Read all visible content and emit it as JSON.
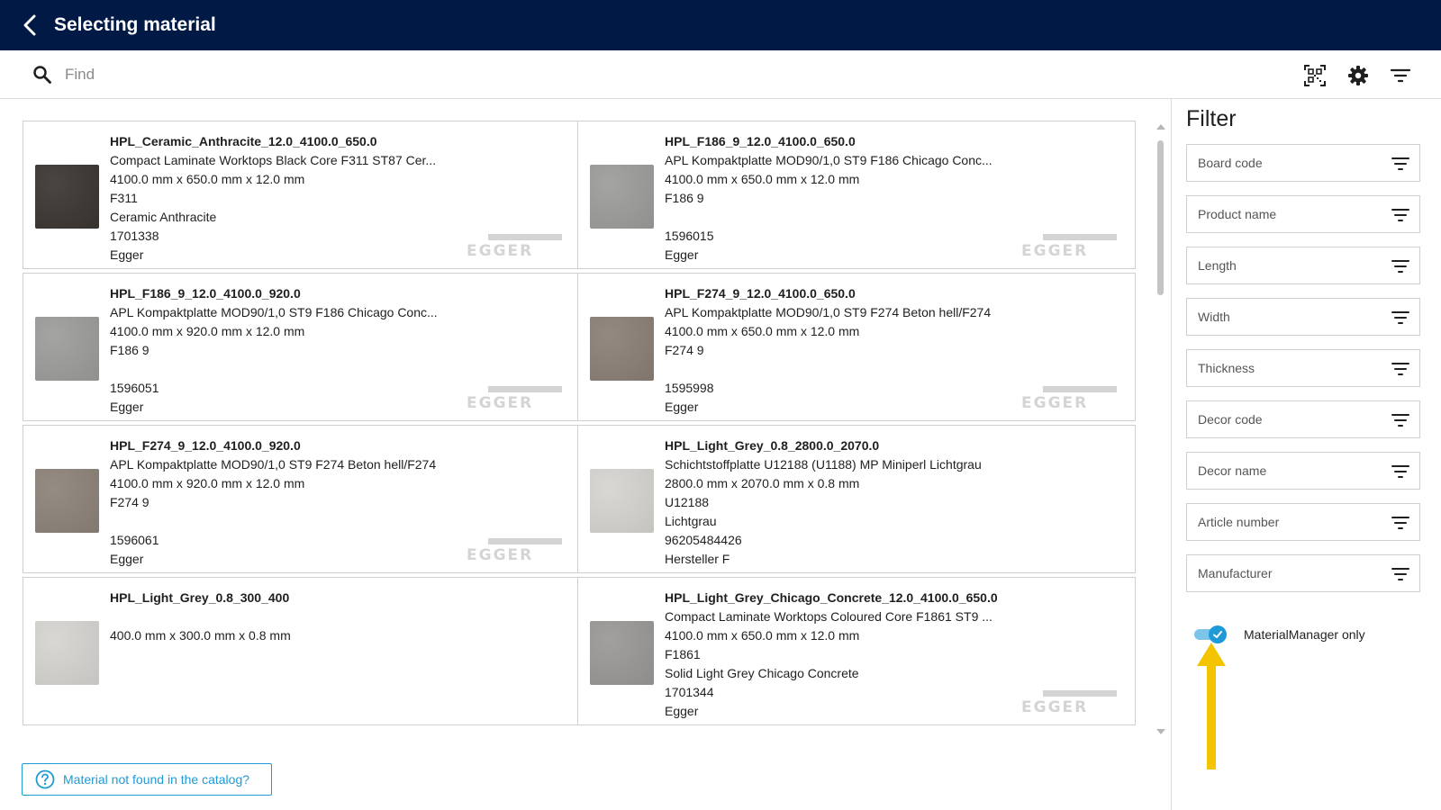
{
  "header": {
    "title": "Selecting material"
  },
  "search": {
    "placeholder": "Find"
  },
  "materials": [
    {
      "name": "HPL_Ceramic_Anthracite_12.0_4100.0_650.0",
      "desc": "Compact Laminate Worktops Black Core F311 ST87 Cer...",
      "dims": "4100.0 mm x 650.0 mm x 12.0 mm",
      "decor_code": "F311",
      "decor_name": "Ceramic Anthracite",
      "article": "1701338",
      "manufacturer": "Egger",
      "swatch": "#3a3530",
      "logo": "EGGER"
    },
    {
      "name": "HPL_F186_9_12.0_4100.0_650.0",
      "desc": "APL Kompaktplatte MOD90/1,0 ST9 F186 Chicago Conc...",
      "dims": "4100.0 mm x 650.0 mm x 12.0 mm",
      "decor_code": "F186 9",
      "decor_name": "",
      "article": "1596015",
      "manufacturer": "Egger",
      "swatch": "#9c9c9a",
      "logo": "EGGER"
    },
    {
      "name": "HPL_F186_9_12.0_4100.0_920.0",
      "desc": "APL Kompaktplatte MOD90/1,0 ST9 F186 Chicago Conc...",
      "dims": "4100.0 mm x 920.0 mm x 12.0 mm",
      "decor_code": "F186 9",
      "decor_name": "",
      "article": "1596051",
      "manufacturer": "Egger",
      "swatch": "#9c9c9a",
      "logo": "EGGER"
    },
    {
      "name": "HPL_F274_9_12.0_4100.0_650.0",
      "desc": "APL Kompaktplatte MOD90/1,0 ST9 F274 Beton hell/F274",
      "dims": "4100.0 mm x 650.0 mm x 12.0 mm",
      "decor_code": "F274 9",
      "decor_name": "",
      "article": "1595998",
      "manufacturer": "Egger",
      "swatch": "#8a7f75",
      "logo": "EGGER"
    },
    {
      "name": "HPL_F274_9_12.0_4100.0_920.0",
      "desc": "APL Kompaktplatte MOD90/1,0 ST9 F274 Beton hell/F274",
      "dims": "4100.0 mm x 920.0 mm x 12.0 mm",
      "decor_code": "F274 9",
      "decor_name": "",
      "article": "1596061",
      "manufacturer": "Egger",
      "swatch": "#8c8278",
      "logo": "EGGER"
    },
    {
      "name": "HPL_Light_Grey_0.8_2800.0_2070.0",
      "desc": "Schichtstoffplatte U12188 (U1188) MP Miniperl Lichtgrau",
      "dims": "2800.0 mm x 2070.0 mm x 0.8 mm",
      "decor_code": "U12188",
      "decor_name": "Lichtgrau",
      "article": "96205484426",
      "manufacturer": "Hersteller F",
      "swatch": "#d6d4d0",
      "logo": ""
    },
    {
      "name": "HPL_Light_Grey_0.8_300_400",
      "desc": "",
      "dims": "400.0 mm x 300.0 mm x 0.8 mm",
      "decor_code": "",
      "decor_name": "",
      "article": "",
      "manufacturer": "",
      "swatch": "#d6d4d0",
      "logo": ""
    },
    {
      "name": "HPL_Light_Grey_Chicago_Concrete_12.0_4100.0_650.0",
      "desc": "Compact Laminate Worktops Coloured Core F1861 ST9 ...",
      "dims": "4100.0 mm x 650.0 mm x 12.0 mm",
      "decor_code": "F1861",
      "decor_name": "Solid Light Grey Chicago Concrete",
      "article": "1701344",
      "manufacturer": "Egger",
      "swatch": "#9a9896",
      "logo": "EGGER"
    }
  ],
  "not_found_label": "Material not found in the catalog?",
  "filter": {
    "title": "Filter",
    "fields": [
      "Board code",
      "Product name",
      "Length",
      "Width",
      "Thickness",
      "Decor code",
      "Decor name",
      "Article number",
      "Manufacturer"
    ],
    "toggle_label": "MaterialManager only",
    "toggle_on": true
  },
  "colors": {
    "header_bg": "#001a45",
    "accent": "#1e9ad6",
    "arrow": "#f5c400"
  },
  "icons": {
    "back": "chevron-left-icon",
    "search": "search-icon",
    "qr": "qr-code-icon",
    "settings": "gear-icon",
    "filter": "filter-lines-icon",
    "help": "question-circle-icon"
  }
}
